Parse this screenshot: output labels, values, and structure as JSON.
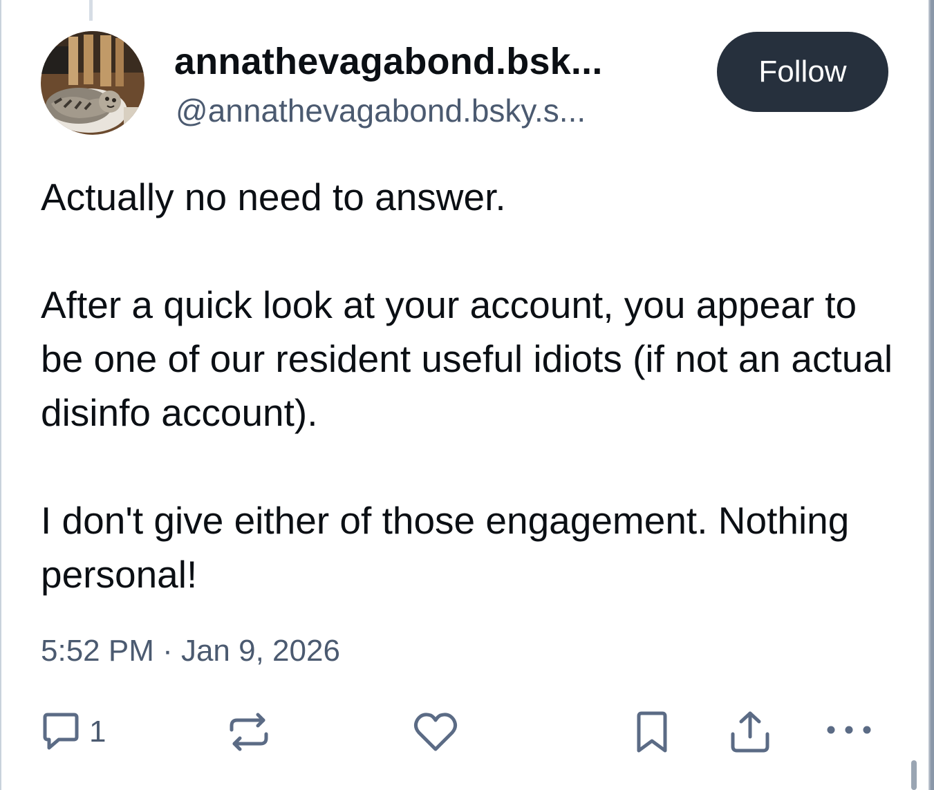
{
  "author": {
    "display_name": "annathevagabond.bsk...",
    "handle": "@annathevagabond.bsky.s..."
  },
  "follow_label": "Follow",
  "post": {
    "paragraphs": [
      "Actually no need to answer.",
      "After a quick look at your account, you appear to be one of our resident useful idiots (if not an actual disinfo account).",
      "I don't give either of those engagement. Nothing personal!"
    ],
    "timestamp": "5:52 PM · Jan 9, 2026"
  },
  "actions": {
    "reply_count": "1",
    "icons": [
      "reply-icon",
      "repost-icon",
      "like-icon",
      "bookmark-icon",
      "share-icon",
      "more-icon"
    ]
  },
  "colors": {
    "text": "#0b0f14",
    "muted": "#4b5a70",
    "icon": "#5b6b85",
    "button_bg": "#26303d",
    "button_text": "#ffffff"
  }
}
